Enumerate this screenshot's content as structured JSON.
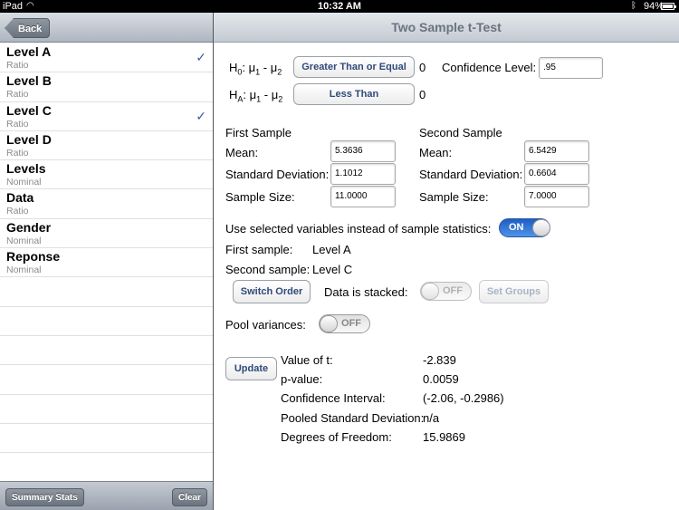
{
  "status": {
    "carrier": "iPad",
    "time": "10:32 AM",
    "battery": "94%"
  },
  "left": {
    "back_label": "Back",
    "items": [
      {
        "name": "Level A",
        "type": "Ratio",
        "checked": true
      },
      {
        "name": "Level B",
        "type": "Ratio",
        "checked": false
      },
      {
        "name": "Level C",
        "type": "Ratio",
        "checked": true
      },
      {
        "name": "Level D",
        "type": "Ratio",
        "checked": false
      },
      {
        "name": "Levels",
        "type": "Nominal",
        "checked": false
      },
      {
        "name": "Data",
        "type": "Ratio",
        "checked": false
      },
      {
        "name": "Gender",
        "type": "Nominal",
        "checked": false
      },
      {
        "name": "Reponse",
        "type": "Nominal",
        "checked": false
      }
    ],
    "summary_stats_label": "Summary Stats",
    "clear_label": "Clear"
  },
  "main": {
    "title": "Two Sample t-Test",
    "h0": {
      "prefix": "H",
      "sub": "0",
      "expr": ": μ",
      "sub1": "1",
      "mid": " - μ",
      "sub2": "2",
      "button": "Greater Than or Equal",
      "value": "0"
    },
    "ha": {
      "prefix": "H",
      "sub": "A",
      "expr": ": μ",
      "sub1": "1",
      "mid": " - μ",
      "sub2": "2",
      "button": "Less Than",
      "value": "0"
    },
    "confidence_label": "Confidence Level:",
    "confidence_value": ".95",
    "first_sample": {
      "header": "First Sample",
      "mean_label": "Mean:",
      "mean": "5.3636",
      "sd_label": "Standard Deviation:",
      "sd": "1.1012",
      "n_label": "Sample Size:",
      "n": "11.0000"
    },
    "second_sample": {
      "header": "Second Sample",
      "mean_label": "Mean:",
      "mean": "6.5429",
      "sd_label": "Standard Deviation:",
      "sd": "0.6604",
      "n_label": "Sample Size:",
      "n": "7.0000"
    },
    "use_selected_label": "Use selected variables instead of sample statistics:",
    "use_selected_toggle": "ON",
    "first_sample_label": "First sample:",
    "first_sample_value": "Level A",
    "second_sample_label": "Second sample:",
    "second_sample_value": "Level C",
    "switch_order_label": "Switch Order",
    "stacked_label": "Data is stacked:",
    "stacked_toggle": "OFF",
    "set_groups_label": "Set Groups",
    "pool_label": "Pool variances:",
    "pool_toggle": "OFF",
    "update_label": "Update",
    "results": [
      {
        "label": "Value of t:",
        "value": "-2.839"
      },
      {
        "label": "p-value:",
        "value": "0.0059"
      },
      {
        "label": "Confidence Interval:",
        "value": "(-2.06, -0.2986)"
      },
      {
        "label": "Pooled Standard Deviation:",
        "value": "n/a"
      },
      {
        "label": "Degrees of Freedom:",
        "value": "15.9869"
      }
    ]
  }
}
